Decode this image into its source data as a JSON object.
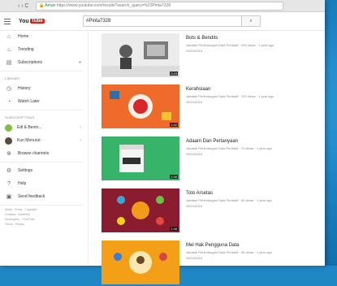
{
  "browser": {
    "nav_glyphs": "‹ › C",
    "secure_label": "🔒 Aman",
    "url": "https://www.youtube.com/results?search_query=%23Pinta7328"
  },
  "header": {
    "logo_text": "You",
    "logo_tube": "Tube",
    "search_value": "#Pinta7328",
    "search_glyph": "⌕"
  },
  "sidebar": {
    "items": [
      {
        "label": "Home",
        "icon": "⌂"
      },
      {
        "label": "Trending",
        "icon": "♨"
      },
      {
        "label": "Subscriptions",
        "icon": "▤"
      }
    ],
    "library_title": "LIBRARY",
    "library": [
      {
        "label": "History",
        "icon": "◷"
      },
      {
        "label": "Watch Later",
        "icon": "◔"
      }
    ],
    "subs_title": "SUBSCRIPTIONS",
    "subs": [
      {
        "label": "Edi & Bento...",
        "color": "#7fbf3f"
      },
      {
        "label": "Kun Menurut",
        "color": "#5a4b3a"
      }
    ],
    "browse": {
      "label": "Browse channels",
      "icon": "⊕"
    },
    "bottom": [
      {
        "label": "Settings",
        "icon": "⚙"
      },
      {
        "label": "Help",
        "icon": "?"
      },
      {
        "label": "Send feedback",
        "icon": "▣"
      }
    ],
    "footer_lines": [
      "About · Press · Copyright",
      "Creators · Advertise",
      "Developers · +YouTube",
      "Terms · Privacy"
    ]
  },
  "videos": [
    {
      "title": "Bots & Bendits",
      "channel": "Jabatan Perlindungan Data Peribadi",
      "views": "203 views · 1 year ago",
      "date": "29/10/2019",
      "duration": "2:15",
      "color": "#e9e9e9"
    },
    {
      "title": "Kerahsiaan",
      "channel": "Jabatan Perlindungan Data Peribadi",
      "views": "123 views · 1 year ago",
      "date": "29/10/2019",
      "duration": "1:52",
      "color": "#ef6b2b"
    },
    {
      "title": "Adaam Dan Pertanyaan",
      "channel": "Jabatan Perlindungan Data Peribadi",
      "views": "70 views · 1 year ago",
      "date": "29/10/2019",
      "duration": "1:58",
      "color": "#37b46a"
    },
    {
      "title": "Toto Arsetas",
      "channel": "Jabatan Perlindungan Data Peribadi",
      "views": "84 views · 1 year ago",
      "date": "29/10/2019",
      "duration": "1:48",
      "color": "#8b1b2e"
    },
    {
      "title": "Mel Hak Pengguna Data",
      "channel": "Jabatan Perlindungan Data Peribadi",
      "views": "55 views · 1 year ago",
      "date": "29/10/2019",
      "duration": "2:01",
      "color": "#f3a018"
    }
  ]
}
